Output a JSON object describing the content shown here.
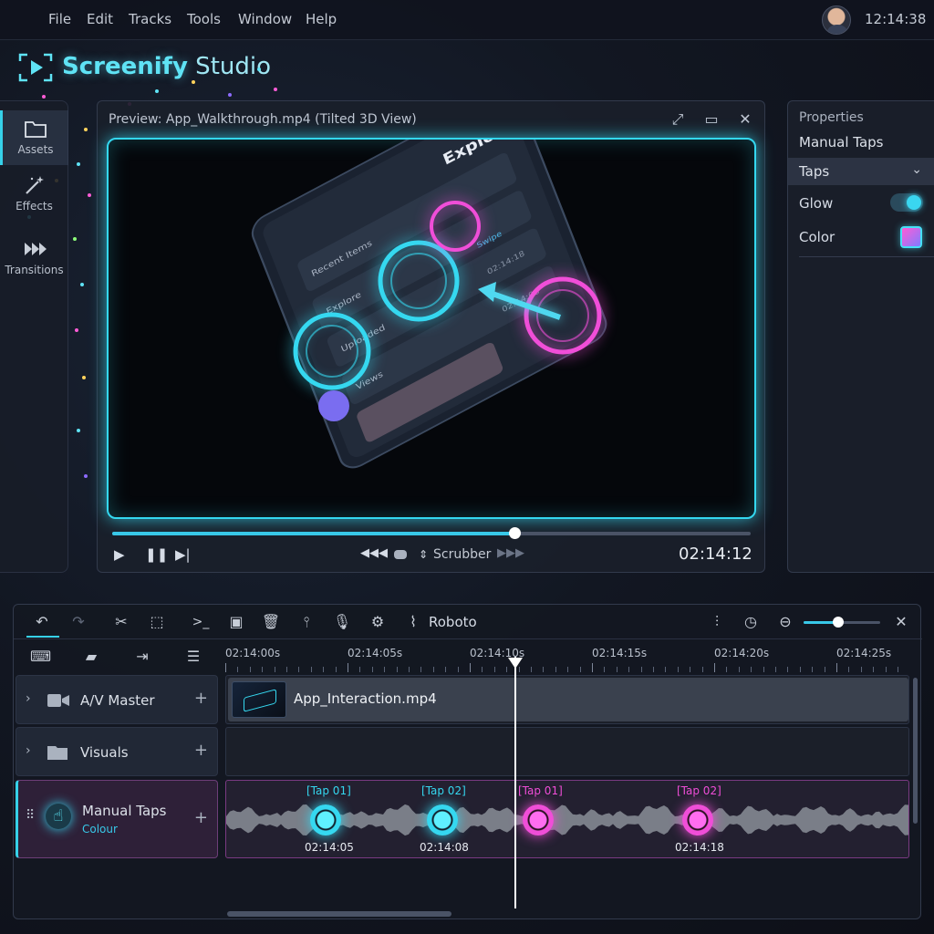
{
  "menu": {
    "items": [
      "File",
      "Edit",
      "Tracks",
      "Tools",
      "Window",
      "Help"
    ],
    "clock": "12:14:38"
  },
  "app": {
    "title_part1": "Screenify",
    "title_part2": " Studio"
  },
  "rail": {
    "assets": "Assets",
    "effects": "Effects",
    "transitions": "Transitions"
  },
  "preview": {
    "title": "Preview: App_Walkthrough.mp4 (Tilted 3D View)",
    "progress": 0.63,
    "scrubber_label": "Scrubber",
    "timecode": "02:14:12",
    "phone": {
      "header": "Explore",
      "rows": [
        "Recent Items",
        "Explore",
        "Uploaded",
        "Views"
      ],
      "times": [
        "02:14:18",
        "02:14:08"
      ],
      "swipe": "Swipe"
    }
  },
  "properties": {
    "title": "Properties",
    "subtitle": "Manual Taps",
    "section": "Taps",
    "glow_label": "Glow",
    "glow_on": true,
    "color_label": "Color"
  },
  "timeline": {
    "font_name": "Roboto",
    "zoom": 0.45,
    "ruler": [
      "02:14:00s",
      "02:14:05s",
      "02:14:10s",
      "02:14:15s",
      "02:14:20s",
      "02:14:25s"
    ],
    "tracks": [
      {
        "name": "A/V Master",
        "clip": "App_Interaction.mp4"
      },
      {
        "name": "Visuals"
      },
      {
        "name": "Manual Taps",
        "subtitle": "Colour"
      }
    ],
    "taps": [
      {
        "label": "[Tap 01]",
        "time": "02:14:05",
        "color": "#35d8f0"
      },
      {
        "label": "[Tap 02]",
        "time": "02:14:08",
        "color": "#35d8f0"
      },
      {
        "label": "[Tap 01]",
        "time": "",
        "color": "#f04ed8"
      },
      {
        "label": "[Tap 02]",
        "time": "02:14:18",
        "color": "#f04ed8"
      }
    ]
  },
  "colors": {
    "accent_cyan": "#35d8f0",
    "accent_pink": "#f04ed8"
  }
}
